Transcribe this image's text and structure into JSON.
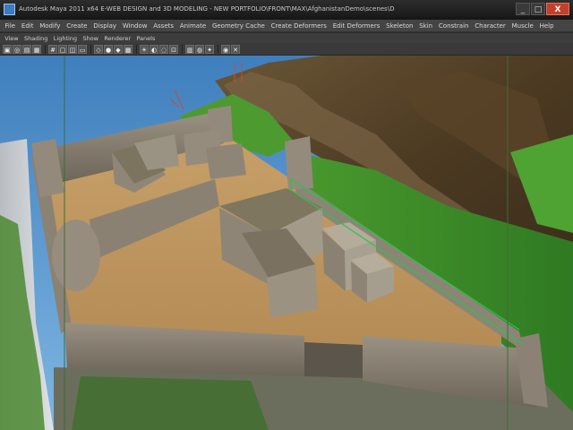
{
  "window": {
    "title": "Autodesk Maya 2011 x64 E-WEB DESIGN and 3D MODELING - NEW PORTFOLIO\\FRONT\\MAX\\AfghanistanDemo\\scenes\\Demo.mb* --- persp.mesh\\WallS",
    "controls": [
      "minimize",
      "maximize",
      "close"
    ],
    "control_glyphs": {
      "minimize": "_",
      "maximize": "□",
      "close": "X"
    }
  },
  "menu": [
    "File",
    "Edit",
    "Modify",
    "Create",
    "Display",
    "Window",
    "Assets",
    "Animate",
    "Geometry Cache",
    "Create Deformers",
    "Edit Deformers",
    "Skeleton",
    "Skin",
    "Constrain",
    "Character",
    "Muscle",
    "Help"
  ],
  "panel_menu": [
    "View",
    "Shading",
    "Lighting",
    "Show",
    "Renderer",
    "Panels"
  ],
  "toolbar_icons": [
    {
      "name": "select-camera-icon",
      "glyph": "▣"
    },
    {
      "name": "camera-attributes-icon",
      "glyph": "◎"
    },
    {
      "name": "bookmark-icon",
      "glyph": "▤"
    },
    {
      "name": "image-plane-icon",
      "glyph": "▦"
    },
    {
      "name": "grid-icon",
      "glyph": "#"
    },
    {
      "name": "film-gate-icon",
      "glyph": "▢"
    },
    {
      "name": "resolution-gate-icon",
      "glyph": "◫"
    },
    {
      "name": "safe-action-icon",
      "glyph": "▭"
    },
    {
      "name": "wireframe-icon",
      "glyph": "◇"
    },
    {
      "name": "smooth-shade-icon",
      "glyph": "●"
    },
    {
      "name": "wireframe-on-shaded-icon",
      "glyph": "◆"
    },
    {
      "name": "textured-icon",
      "glyph": "▩"
    },
    {
      "name": "use-lights-icon",
      "glyph": "☀"
    },
    {
      "name": "shadows-icon",
      "glyph": "◐"
    },
    {
      "name": "xray-icon",
      "glyph": "◌"
    },
    {
      "name": "isolate-select-icon",
      "glyph": "⊡"
    },
    {
      "name": "hud-icon",
      "glyph": "▥"
    },
    {
      "name": "ambient-occlusion-icon",
      "glyph": "◍"
    },
    {
      "name": "anti-alias-icon",
      "glyph": "✦"
    },
    {
      "name": "depth-of-field-icon",
      "glyph": "◉"
    },
    {
      "name": "manipulator-icon",
      "glyph": "✕"
    }
  ],
  "colors": {
    "sky": "#4e8fc8",
    "selection_outline": "#23c845",
    "camera_gate": "#3e6b3a",
    "ground_sand": "#c69f67",
    "wall_stone": "#8a8174",
    "grass": "#3f8d2a"
  }
}
